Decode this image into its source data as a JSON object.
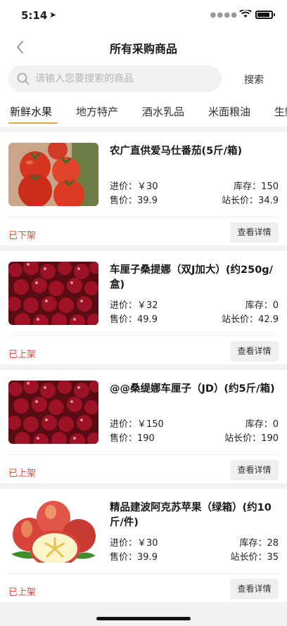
{
  "status_bar": {
    "time": "5:14"
  },
  "nav": {
    "title": "所有采购商品"
  },
  "search": {
    "placeholder": "请输入您要搜索的商品",
    "button": "搜索"
  },
  "tabs": [
    {
      "label": "新鲜水果",
      "active": true
    },
    {
      "label": "地方特产"
    },
    {
      "label": "酒水乳品"
    },
    {
      "label": "米面粮油"
    },
    {
      "label": "生鲜"
    }
  ],
  "labels": {
    "purchase_price": "进价：",
    "sale_price": "售价：",
    "stock": "库存：",
    "station_price": "站长价：",
    "detail": "查看详情"
  },
  "products": [
    {
      "name": "农广直供爱马仕番茄(5斤/箱)",
      "purchase_price": "￥30",
      "sale_price": "39.9",
      "stock": "150",
      "station_price": "34.9",
      "status": "已下架",
      "image": "tomato-image"
    },
    {
      "name": "车厘子桑提娜（双J加大）(约250g/盒)",
      "purchase_price": "￥32",
      "sale_price": "49.9",
      "stock": "0",
      "station_price": "42.9",
      "status": "已上架",
      "image": "cherry-image"
    },
    {
      "name": "@@桑缇娜车厘子（JD）(约5斤/箱)",
      "purchase_price": "￥150",
      "sale_price": "190",
      "stock": "0",
      "station_price": "190",
      "status": "已上架",
      "image": "cherry-image"
    },
    {
      "name": "精品建波阿克苏苹果（绿箱）(约10斤/件)",
      "purchase_price": "￥30",
      "sale_price": "39.9",
      "stock": "28",
      "station_price": "35",
      "status": "已上架",
      "image": "apple-image"
    }
  ]
}
